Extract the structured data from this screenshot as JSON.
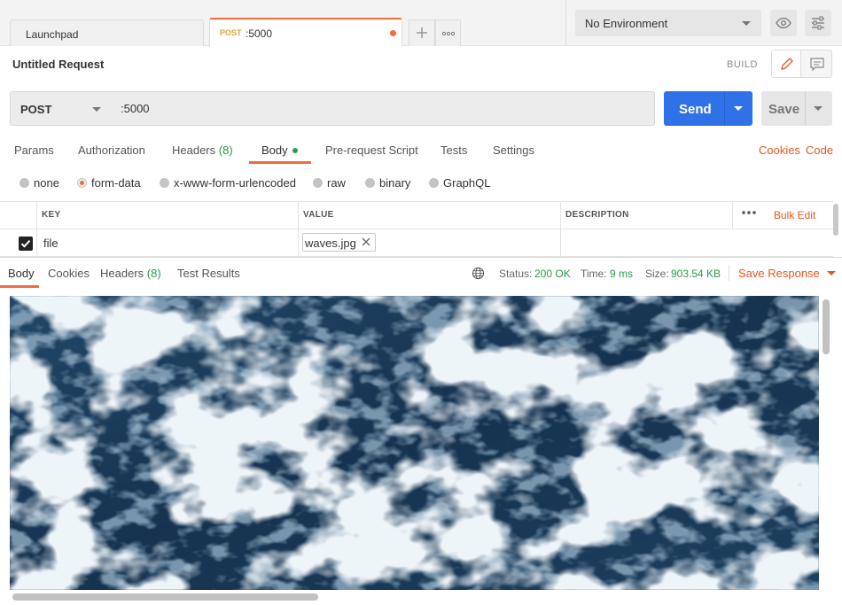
{
  "tabs": {
    "launchpad": "Launchpad",
    "active": {
      "method": "POST",
      "url": ":5000"
    }
  },
  "environment": {
    "selected": "No Environment"
  },
  "request": {
    "title": "Untitled Request",
    "mode_label": "BUILD",
    "method": "POST",
    "url": ":5000",
    "send_label": "Send",
    "save_label": "Save"
  },
  "request_tabs": {
    "params": "Params",
    "authorization": "Authorization",
    "headers": "Headers",
    "headers_count": "(8)",
    "body": "Body",
    "prerequest": "Pre-request Script",
    "tests": "Tests",
    "settings": "Settings",
    "cookies": "Cookies",
    "code": "Code"
  },
  "body_types": [
    "none",
    "form-data",
    "x-www-form-urlencoded",
    "raw",
    "binary",
    "GraphQL"
  ],
  "body_type_selected": "form-data",
  "form_table": {
    "columns": {
      "key": "KEY",
      "value": "VALUE",
      "description": "DESCRIPTION"
    },
    "bulk_edit": "Bulk Edit",
    "rows": [
      {
        "key": "file",
        "value": "waves.jpg",
        "checked": true,
        "description": ""
      }
    ]
  },
  "response": {
    "tabs": {
      "body": "Body",
      "cookies": "Cookies",
      "headers": "Headers",
      "headers_count": "(8)",
      "test_results": "Test Results"
    },
    "status_label": "Status:",
    "status_value": "200 OK",
    "time_label": "Time:",
    "time_value": "9 ms",
    "size_label": "Size:",
    "size_value": "903.54 KB",
    "save_label": "Save Response"
  },
  "colors": {
    "accent": "#f26b3a",
    "send": "#2f72e7",
    "success": "#2b9a4a",
    "link": "#e0591f"
  }
}
